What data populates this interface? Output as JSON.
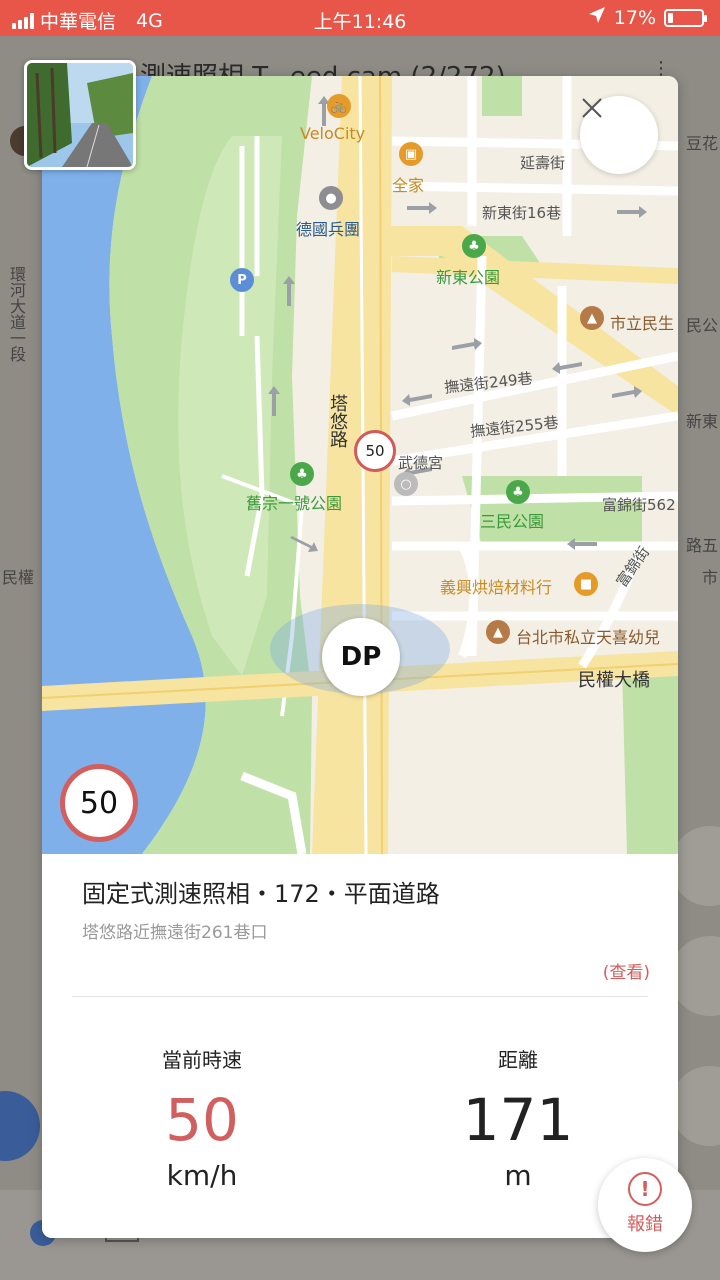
{
  "status_bar": {
    "carrier": "中華電信",
    "network": "4G",
    "time": "上午11:46",
    "battery": "17%",
    "battery_level": 0.17
  },
  "background": {
    "title": "測速照相 T...eed cam (2/272)",
    "left_road_labels": [
      "環河大道一段",
      "民權"
    ],
    "right_labels": [
      "豆花",
      "民公",
      "新東",
      "路五",
      "市"
    ]
  },
  "modal": {
    "close_icon": "close-icon",
    "map": {
      "pois": {
        "velocity": "VeloCity",
        "family_mart": "全家",
        "germany_barracks": "德國兵團",
        "xindong_park": "新東公園",
        "minsheng": "市立民生",
        "jiuzong_park": "舊宗一號公園",
        "wude_temple": "武德宮",
        "sanmin_park": "三民公園",
        "yixing_bakery": "義興烘焙材料行",
        "tianxi_kindergarten": "台北市私立天喜幼兒"
      },
      "streets": {
        "yanshou": "延壽街",
        "xindong16": "新東街16巷",
        "tayou": "塔悠路",
        "fuyuan249": "撫遠街249巷",
        "fuyuan255": "撫遠街255巷",
        "fujin562": "富錦街562",
        "fujin": "富錦街",
        "minquan_bridge": "民權大橋"
      },
      "camera_marker_speed": "50",
      "user_marker_icon": "DP"
    },
    "speed_limit_badge": "50",
    "info": {
      "title": "固定式測速照相・172・平面道路",
      "address": "塔悠路近撫遠街261巷口",
      "view_link": "(查看)",
      "speed": {
        "label": "當前時速",
        "value": "50",
        "unit": "km/h"
      },
      "distance": {
        "label": "距離",
        "value": "171",
        "unit": "m"
      }
    }
  },
  "report_button": {
    "label": "報錯",
    "icon": "exclamation-icon"
  },
  "colors": {
    "status_bar": "#e8564a",
    "accent_red": "#d45d5d",
    "park_green": "#4aa84a",
    "water": "#7fb0ea"
  }
}
